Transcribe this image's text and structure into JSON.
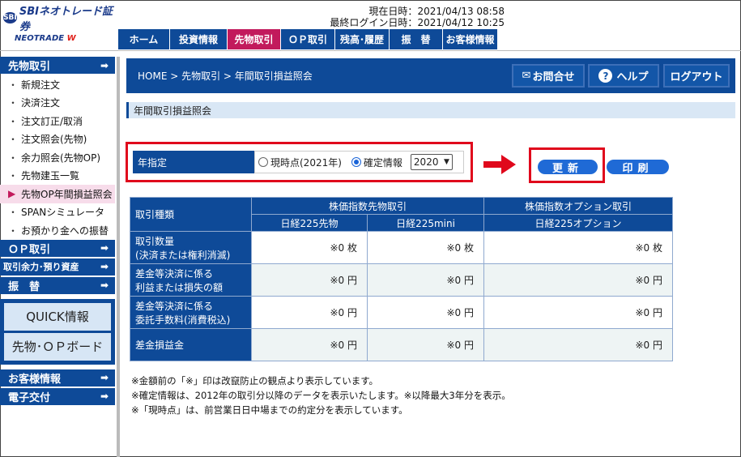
{
  "header": {
    "brand": "SBIネオトレード証券",
    "brand_mark": "SBI",
    "sub_brand": "NEOTRADE",
    "sub_brand_w": "W",
    "current_time_label": "現在日時：",
    "current_time": "2021/04/13 08:58",
    "last_login_label": "最終ログイン日時：",
    "last_login": "2021/04/12 10:25"
  },
  "topnav": [
    "ホーム",
    "投資情報",
    "先物取引",
    "ＯＰ取引",
    "残高･履歴",
    "振　替",
    "お客様情報"
  ],
  "sidebar": {
    "section": "先物取引",
    "items": [
      "新規注文",
      "決済注文",
      "注文訂正/取消",
      "注文照会(先物)",
      "余力照会(先物OP)",
      "先物建玉一覧",
      "先物OP年間損益照会",
      "SPANシミュレータ",
      "お預かり金への振替"
    ],
    "op": "ＯＰ取引",
    "margin": "取引余力･預り資産",
    "transfer": "振　替",
    "quick": "QUICK情報",
    "board": "先物･ＯＰボード",
    "customer": "お客様情報",
    "edelivery": "電子交付"
  },
  "crumb": "HOME > 先物取引 > 年間取引損益照会",
  "buttons": {
    "contact": "お問合せ",
    "help": "ヘルプ",
    "logout": "ログアウト",
    "update": "更新",
    "print": "印刷"
  },
  "subtitle": "年間取引損益照会",
  "year": {
    "label": "年指定",
    "opt_current": "現時点(2021年)",
    "opt_fixed": "確定情報",
    "selected": "2020"
  },
  "table": {
    "corner": "取引種類",
    "group1": "株価指数先物取引",
    "group2": "株価指数オプション取引",
    "cols": [
      "日経225先物",
      "日経225mini",
      "日経225オプション"
    ],
    "rows": [
      {
        "label1": "取引数量",
        "label2": "(決済または権利消滅)",
        "vals": [
          "※0 枚",
          "※0 枚",
          "※0 枚"
        ]
      },
      {
        "label1": "差金等決済に係る",
        "label2": "利益または損失の額",
        "vals": [
          "※0 円",
          "※0 円",
          "※0 円"
        ]
      },
      {
        "label1": "差金等決済に係る",
        "label2": "委託手数料(消費税込)",
        "vals": [
          "※0 円",
          "※0 円",
          "※0 円"
        ]
      },
      {
        "label1": "差金損益金",
        "label2": "",
        "vals": [
          "※0 円",
          "※0 円",
          "※0 円"
        ]
      }
    ]
  },
  "notes": [
    "※金額前の「※」印は改竄防止の観点より表示しています。",
    "※確定情報は、2012年の取引分以降のデータを表示いたします。※以降最大3年分を表示。",
    "※「現時点」は、前営業日日中場までの約定分を表示しています。"
  ]
}
